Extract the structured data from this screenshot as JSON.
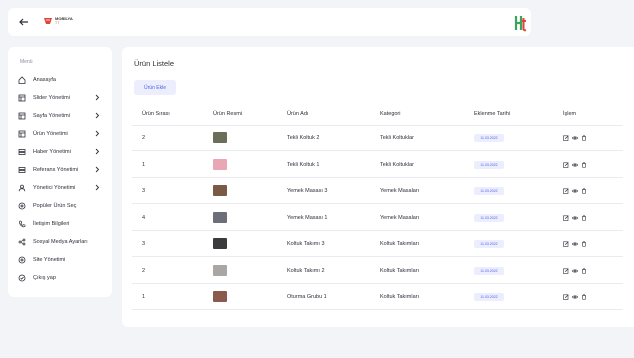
{
  "header": {
    "brand_name": "MOBİLYA",
    "brand_sub": "TT"
  },
  "sidebar": {
    "title": "Menü",
    "items": [
      {
        "label": "Anasayfa",
        "icon": "home-icon",
        "chevron": false
      },
      {
        "label": "Slider Yönetimi",
        "icon": "layout-icon",
        "chevron": true
      },
      {
        "label": "Sayfa Yönetimi",
        "icon": "layout-icon",
        "chevron": true
      },
      {
        "label": "Ürün Yönetimi",
        "icon": "layout-icon",
        "chevron": true
      },
      {
        "label": "Haber Yönetimi",
        "icon": "layers-icon",
        "chevron": true
      },
      {
        "label": "Referans Yönetimi",
        "icon": "layers-icon",
        "chevron": true
      },
      {
        "label": "Yönetici Yönetimi",
        "icon": "user-icon",
        "chevron": true
      },
      {
        "label": "Popüler Ürün Seç",
        "icon": "settings-icon",
        "chevron": false
      },
      {
        "label": "İletişim Bilgileri",
        "icon": "phone-icon",
        "chevron": false
      },
      {
        "label": "Sosyal Medya Ayarları",
        "icon": "share-icon",
        "chevron": false
      },
      {
        "label": "Site Yönetimi",
        "icon": "settings-icon",
        "chevron": false
      },
      {
        "label": "Çıkış yap",
        "icon": "logout-icon",
        "chevron": false
      }
    ]
  },
  "main": {
    "title": "Ürün Listele",
    "add_button": "Ürün Ekle",
    "columns": [
      "Ürün Sırası",
      "Ürün Resmi",
      "Ürün Adı",
      "Kategori",
      "Eklenme Tarihi",
      "İşlem"
    ],
    "rows": [
      {
        "order": "2",
        "name": "Tekli Koltuk 2",
        "category": "Tekli Koltuklar",
        "date": "11.03.2022",
        "thumb": "#6b6e58"
      },
      {
        "order": "1",
        "name": "Tekli Koltuk 1",
        "category": "Tekli Koltuklar",
        "date": "11.03.2022",
        "thumb": "#e9a7b6"
      },
      {
        "order": "3",
        "name": "Yemek Masası 3",
        "category": "Yemek Masaları",
        "date": "11.03.2022",
        "thumb": "#7a5a44"
      },
      {
        "order": "4",
        "name": "Yemek Masası 1",
        "category": "Yemek Masaları",
        "date": "11.03.2022",
        "thumb": "#6c6f78"
      },
      {
        "order": "3",
        "name": "Koltuk Takımı 3",
        "category": "Koltuk Takımları",
        "date": "11.03.2022",
        "thumb": "#3b3a3d"
      },
      {
        "order": "2",
        "name": "Koltuk Takımı 2",
        "category": "Koltuk Takımları",
        "date": "11.03.2022",
        "thumb": "#a9a6a3"
      },
      {
        "order": "1",
        "name": "Oturma Grubu 1",
        "category": "Koltuk Takımları",
        "date": "11.03.2022",
        "thumb": "#8a5a4c"
      }
    ]
  },
  "colors": {
    "accent": "#5161e8",
    "brand_orange": "#e06a2b",
    "brand_green": "#3aa65b",
    "brand_red": "#e0453a"
  }
}
